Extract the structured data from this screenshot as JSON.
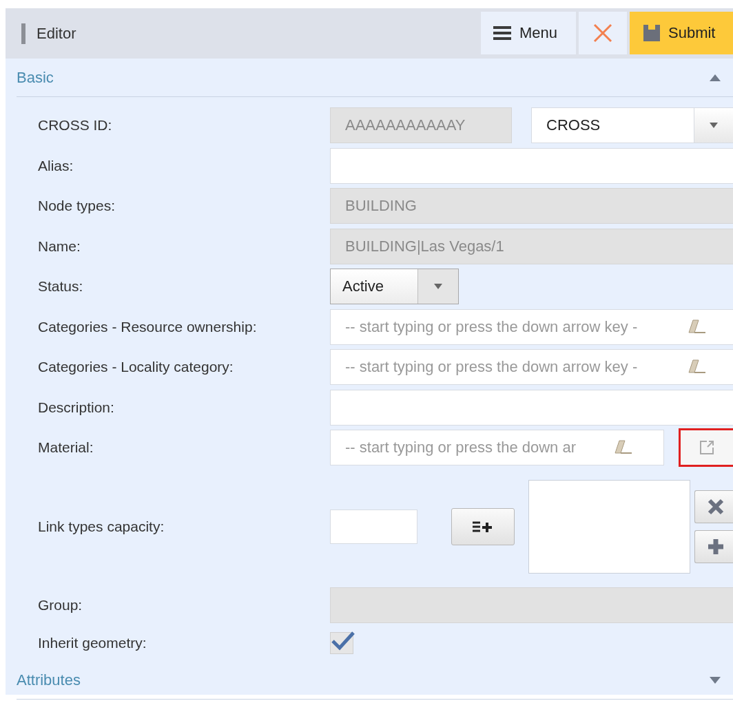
{
  "header": {
    "title": "Editor",
    "menu_button": "Menu",
    "submit_button": "Submit"
  },
  "sections": [
    {
      "title": "Basic",
      "expanded": true,
      "fields": [
        {
          "kind": "readonly-select",
          "label": "CROSS ID:",
          "value": "AAAAAAAAAAAY",
          "select": "CROSS"
        },
        {
          "kind": "text",
          "label": "Alias:"
        },
        {
          "kind": "readonly",
          "label": "Node types:",
          "value": "BUILDING"
        },
        {
          "kind": "readonly",
          "label": "Name:",
          "value": "BUILDING|Las Vegas/1"
        },
        {
          "kind": "select",
          "label": "Status:",
          "value": "Active"
        },
        {
          "kind": "autocomplete",
          "label": "Categories - Resource ownership:",
          "placeholder": "-- start typing or press the down arrow key -"
        },
        {
          "kind": "autocomplete",
          "label": "Categories - Locality category:",
          "placeholder": "-- start typing or press the down arrow key -"
        },
        {
          "kind": "text",
          "label": "Description:"
        },
        {
          "kind": "material",
          "label": "Material:",
          "placeholder": "-- start typing or press the down ar"
        },
        {
          "kind": "capacity",
          "label": "Link types capacity:"
        },
        {
          "kind": "readonly",
          "label": "Group:"
        },
        {
          "kind": "checkbox",
          "label": "Inherit geometry:",
          "checked": true
        }
      ]
    },
    {
      "title": "Attributes",
      "expanded": false
    }
  ]
}
